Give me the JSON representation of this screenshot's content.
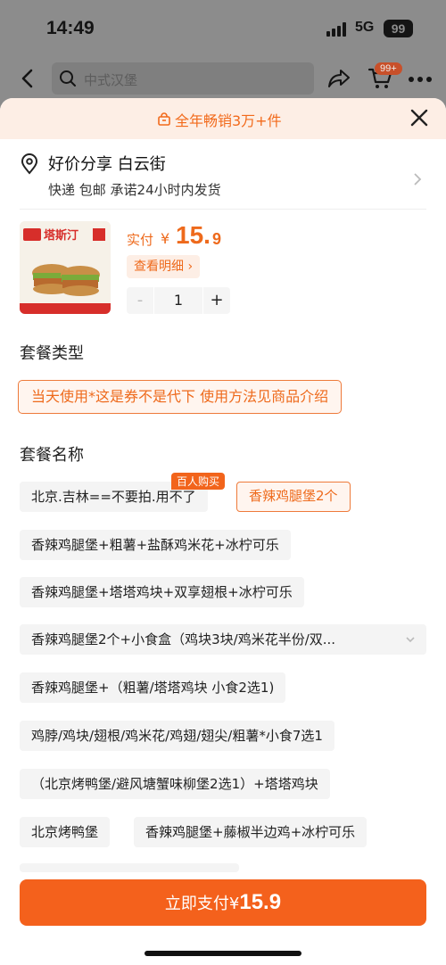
{
  "status": {
    "time": "14:49",
    "network": "5G",
    "battery": "99"
  },
  "nav": {
    "search_placeholder": "中式汉堡",
    "cart_badge": "99+"
  },
  "promo": {
    "text": "全年畅销3万+件"
  },
  "address": {
    "title": "好价分享 白云街",
    "subtitle": "快递 包邮 承诺24小时内发货"
  },
  "product": {
    "brand": "塔斯汀",
    "pay_label": "实付",
    "currency": "¥",
    "price_int": "15.",
    "price_dec": "9",
    "detail_label": "查看明细 ›",
    "minus": "-",
    "quantity": "1",
    "plus": "+"
  },
  "package_type": {
    "title": "套餐类型",
    "option": "当天使用*这是券不是代下 使用方法见商品介绍"
  },
  "package_name": {
    "title": "套餐名称",
    "badge": "百人购买",
    "options": [
      "北京.吉林==不要拍.用不了",
      "香辣鸡腿堡2个",
      "香辣鸡腿堡+粗薯+盐酥鸡米花+冰柠可乐",
      "香辣鸡腿堡+塔塔鸡块+双享翅根+冰柠可乐",
      "香辣鸡腿堡2个+小食盒（鸡块3块/鸡米花半份/双...",
      "香辣鸡腿堡+（粗薯/塔塔鸡块 小食2选1)",
      "鸡脖/鸡块/翅根/鸡米花/鸡翅/翅尖/粗薯*小食7选1",
      "（北京烤鸭堡/避风塘蟹味柳堡2选1）+塔塔鸡块",
      "北京烤鸭堡",
      "香辣鸡腿堡+藤椒半边鸡+冰柠可乐"
    ]
  },
  "paybar": {
    "label": "立即支付",
    "currency": "¥",
    "amount": "15.9"
  },
  "colors": {
    "accent": "#f4611c",
    "accent_light": "#fdeee5"
  }
}
